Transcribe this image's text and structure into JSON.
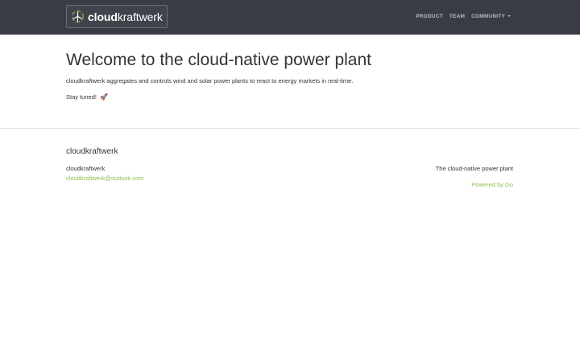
{
  "navbar": {
    "brand_bold": "cloud",
    "brand_light": "kraftwerk",
    "links": [
      {
        "label": "PRODUCT"
      },
      {
        "label": "TEAM"
      },
      {
        "label": "COMMUNITY"
      }
    ],
    "colors": {
      "background": "#393c44",
      "link": "#b9bcc2"
    }
  },
  "hero": {
    "title": "Welcome to the cloud-native power plant",
    "description": "cloudkraftwerk aggregates and controls wind and solar power plants to react to energy markets in real-time.",
    "stay_tuned": "Stay tuned!",
    "emoji": "🚀"
  },
  "footer": {
    "title": "cloudkraftwerk",
    "name": "cloudkraftwerk",
    "email": "cloudkraftwerk@outlook.com",
    "tagline": "The cloud-native power plant",
    "powered_by": "Powered by Go",
    "link_color": "#8cc152"
  }
}
